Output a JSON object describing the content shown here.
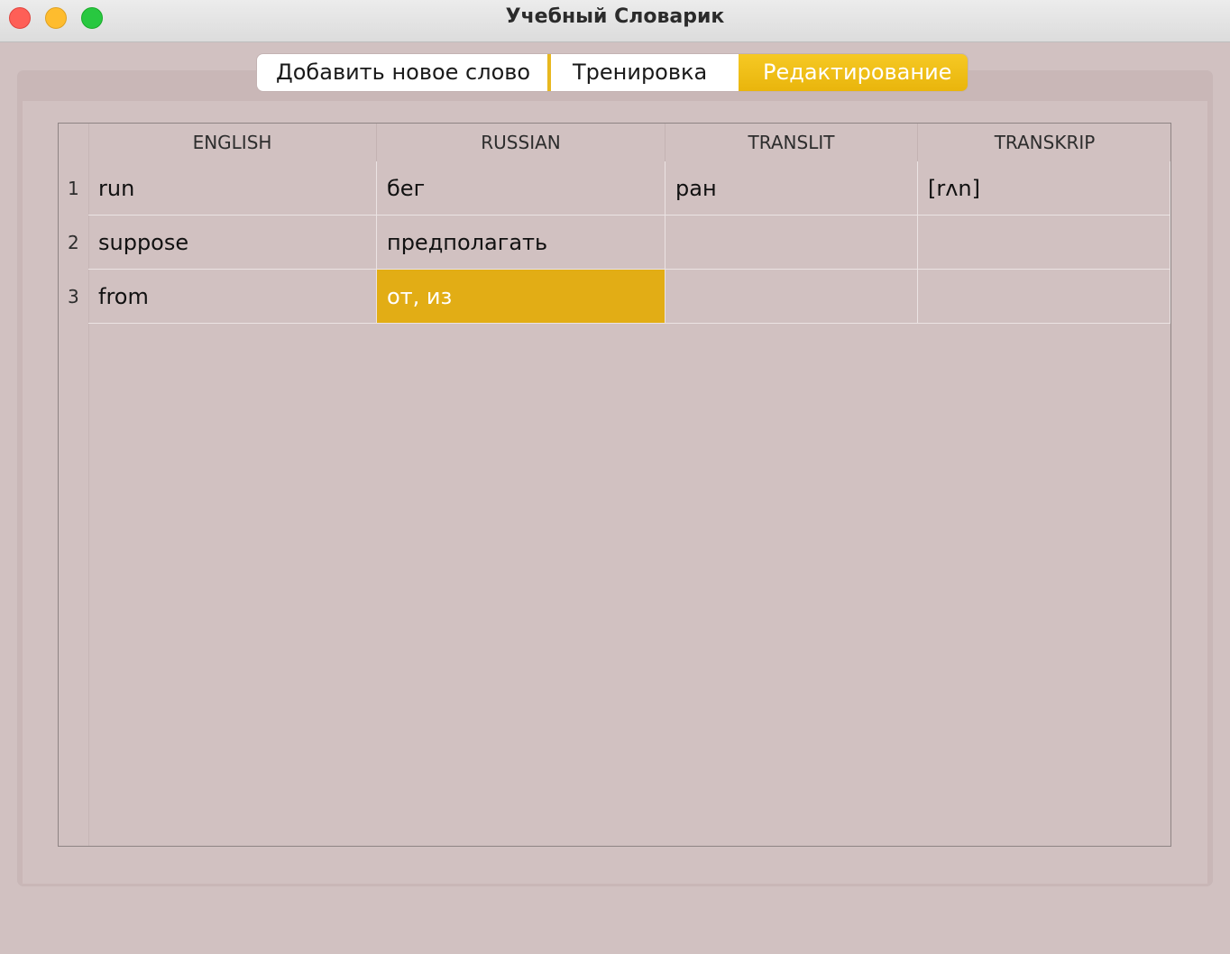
{
  "window": {
    "title": "Учебный Словарик"
  },
  "tabs": [
    {
      "label": "Добавить новое слово",
      "active": false
    },
    {
      "label": "Тренировка",
      "active": false
    },
    {
      "label": "Редактирование",
      "active": true
    }
  ],
  "table": {
    "columns": [
      "ENGLISH",
      "RUSSIAN",
      "TRANSLIT",
      "TRANSKRIP"
    ],
    "rows": [
      {
        "num": "1",
        "english": "run",
        "russian": "бег",
        "translit": "ран",
        "transkrip": "[rʌn]"
      },
      {
        "num": "2",
        "english": "suppose",
        "russian": "предполагать",
        "translit": "",
        "transkrip": ""
      },
      {
        "num": "3",
        "english": "from",
        "russian": "от, из",
        "translit": "",
        "transkrip": ""
      }
    ],
    "selected_cell": {
      "row": 3,
      "column": "RUSSIAN"
    }
  },
  "colors": {
    "background": "#d1c1c1",
    "accent": "#e9b50c",
    "selection": "#e2ad15"
  }
}
